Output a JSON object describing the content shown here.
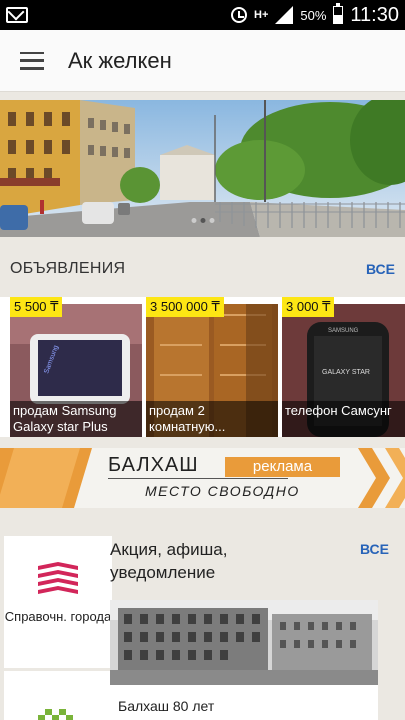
{
  "status_bar": {
    "network": "H+",
    "battery": "50%",
    "time": "11:30",
    "icons": [
      "mail-icon",
      "alarm-icon",
      "signal-icon",
      "battery-icon"
    ]
  },
  "app_bar": {
    "title": "Ак желкен",
    "menu_icon": "hamburger-icon"
  },
  "banner": {
    "slide_count": 3,
    "active_slide": 2
  },
  "ads": {
    "title": "ОБЪЯВЛЕНИЯ",
    "all_label": "ВСЕ",
    "items": [
      {
        "price": "5 500 ₸",
        "caption": "продам Samsung Galaxy star Plus"
      },
      {
        "price": "3 500 000 ₸",
        "caption": "продам 2 комнатную..."
      },
      {
        "price": "3 000 ₸",
        "caption": "телефон Самсунг"
      }
    ]
  },
  "promo": {
    "city": "БАЛХАШ",
    "tag": "реклама",
    "subtitle": "МЕСТО СВОБОДНО"
  },
  "directory": {
    "label": "Справочн. города"
  },
  "events": {
    "title": "Акция, афиша, уведомление",
    "all_label": "ВСЕ",
    "card_caption": "Балхаш 80 лет"
  },
  "colors": {
    "accent_blue": "#2763b8",
    "price_yellow": "#fde614",
    "promo_orange": "#e99b3a",
    "directory_red": "#d2265a",
    "directory_green": "#7ab43a"
  }
}
